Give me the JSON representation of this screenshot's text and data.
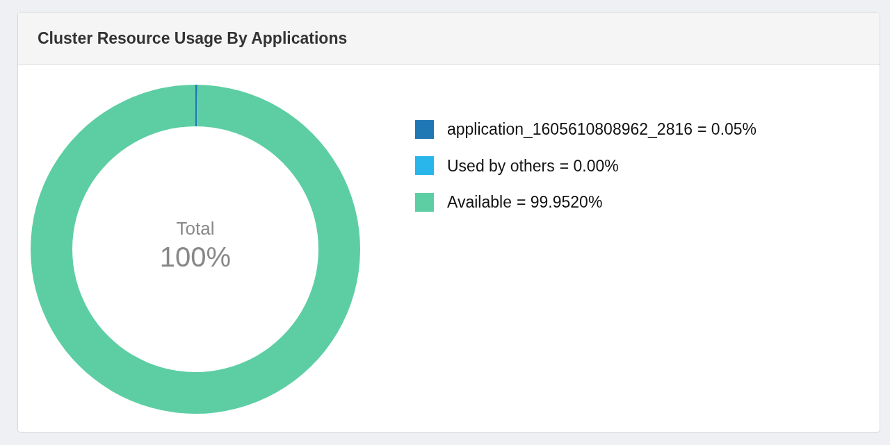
{
  "panel": {
    "title": "Cluster Resource Usage By Applications"
  },
  "chart": {
    "center_label": "Total",
    "center_value": "100%",
    "chart_data": {
      "type": "donut",
      "categories": [
        "application_1605610808962_2816",
        "Used by others",
        "Available"
      ],
      "values": [
        0.05,
        0.0,
        99.952
      ]
    },
    "legend": [
      {
        "reading": "= 0.05%",
        "color": "#1f77b4"
      },
      {
        "reading": "= 0.00%",
        "color": "#29b6ea"
      },
      {
        "reading": "= 99.9520%",
        "color": "#5dcea4"
      }
    ]
  }
}
